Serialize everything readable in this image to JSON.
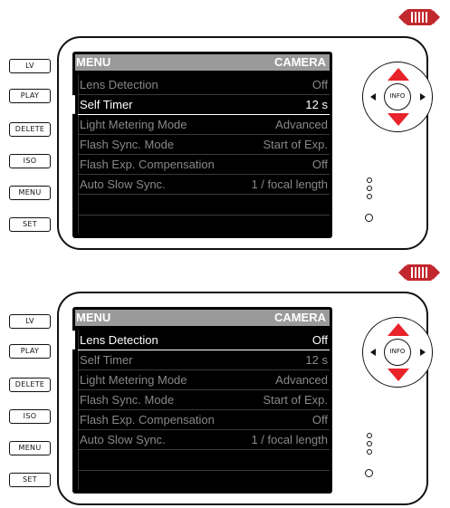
{
  "colors": {
    "accent": "#e8232a",
    "screen_bg": "#000000",
    "header_bg": "#9a9a9a"
  },
  "side_buttons": [
    "LV",
    "PLAY",
    "DELETE",
    "ISO",
    "MENU",
    "SET"
  ],
  "dial": {
    "center_label": "INFO"
  },
  "panels": [
    {
      "header": {
        "left": "MENU",
        "right": "CAMERA"
      },
      "rows": [
        {
          "label": "Lens Detection",
          "value": "Off"
        },
        {
          "label": "Self Timer",
          "value": "12 s"
        },
        {
          "label": "Light Metering Mode",
          "value": "Advanced"
        },
        {
          "label": "Flash Sync. Mode",
          "value": "Start of Exp."
        },
        {
          "label": "Flash Exp. Compensation",
          "value": "Off"
        },
        {
          "label": "Auto Slow Sync.",
          "value": "1 / focal length"
        }
      ],
      "active_row": "Self Timer"
    },
    {
      "header": {
        "left": "MENU",
        "right": "CAMERA"
      },
      "rows": [
        {
          "label": "Lens Detection",
          "value": "Off"
        },
        {
          "label": "Self Timer",
          "value": "12 s"
        },
        {
          "label": "Light Metering Mode",
          "value": "Advanced"
        },
        {
          "label": "Flash Sync. Mode",
          "value": "Start of Exp."
        },
        {
          "label": "Flash Exp. Compensation",
          "value": "Off"
        },
        {
          "label": "Auto Slow Sync.",
          "value": "1 / focal length"
        }
      ],
      "active_row": "Lens Detection"
    }
  ]
}
